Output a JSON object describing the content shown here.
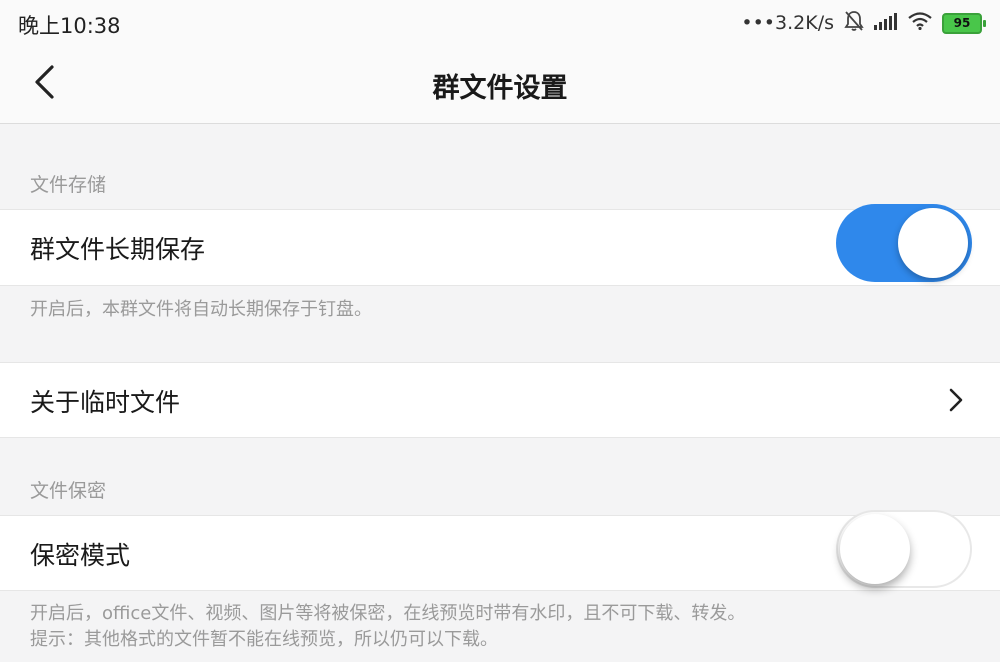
{
  "status_bar": {
    "time": "晚上10:38",
    "network_speed": "•••3.2K/s",
    "battery_level": "95",
    "icons": [
      "mute-bell-icon",
      "signal-icon",
      "wifi-icon",
      "battery-icon"
    ]
  },
  "nav": {
    "title": "群文件设置",
    "back_icon": "back-arrow-icon"
  },
  "storage": {
    "section_title": "文件存储",
    "label": "群文件长期保存",
    "enabled": true,
    "hint": "开启后，本群文件将自动长期保存于钉盘。"
  },
  "temp_files": {
    "label": "关于临时文件",
    "icon": "chevron-right-icon"
  },
  "security": {
    "section_title": "文件保密",
    "label": "保密模式",
    "enabled": false,
    "hint_line1": "开启后，office文件、视频、图片等将被保密，在线预览时带有水印，且不可下载、转发。",
    "hint_line2": "提示：其他格式的文件暂不能在线预览，所以仍可以下载。"
  },
  "colors": {
    "accent": "#2f88eb",
    "background": "#f4f4f5",
    "hint_text": "#9a9a9a",
    "battery": "#49c64a"
  }
}
